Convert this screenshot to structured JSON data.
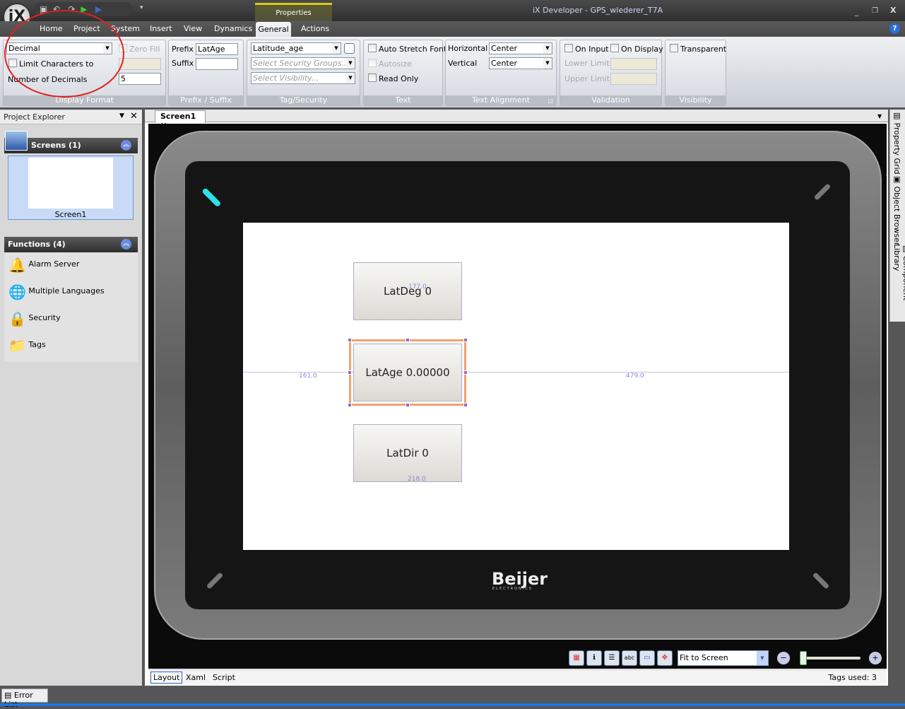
{
  "window": {
    "title": "iX Developer - GPS_wlederer_T7A",
    "logo": "iX",
    "context_tab": "Properties"
  },
  "menu_tabs": [
    "Home",
    "Project",
    "System",
    "Insert",
    "View",
    "Dynamics",
    "General",
    "Actions"
  ],
  "active_tab": "General",
  "ribbon": {
    "display_format": {
      "caption": "Display Format",
      "format_value": "Decimal",
      "zero_fill": "Zero Fill",
      "limit_chars": "Limit Characters to",
      "limit_value": "",
      "decimals_label": "Number of Decimals",
      "decimals_value": "5"
    },
    "prefix_suffix": {
      "caption": "Prefix / Suffix",
      "prefix_label": "Prefix",
      "prefix_value": "LatAge",
      "suffix_label": "Suffix",
      "suffix_value": ""
    },
    "tag_security": {
      "caption": "Tag/Security",
      "tag_value": "Latitude_age",
      "security_placeholder": "Select Security Groups...",
      "visibility_placeholder": "Select Visibility..."
    },
    "text": {
      "caption": "Text",
      "auto_stretch": "Auto Stretch Font",
      "autosize": "Autosize",
      "read_only": "Read Only"
    },
    "text_alignment": {
      "caption": "Text Alignment",
      "horizontal_label": "Horizontal",
      "horizontal_value": "Center",
      "vertical_label": "Vertical",
      "vertical_value": "Center"
    },
    "validation": {
      "caption": "Validation",
      "on_input": "On Input",
      "on_display": "On Display",
      "lower": "Lower Limit",
      "upper": "Upper Limit"
    },
    "visibility": {
      "caption": "Visibility",
      "transparent": "Transparent"
    }
  },
  "project_explorer": {
    "title": "Project Explorer",
    "screens_header": "Screens (1)",
    "screen_name": "Screen1",
    "functions_header": "Functions (4)",
    "functions": [
      {
        "label": "Alarm Server",
        "icon": "bell-icon"
      },
      {
        "label": "Multiple Languages",
        "icon": "globe-icon"
      },
      {
        "label": "Security",
        "icon": "lock-icon"
      },
      {
        "label": "Tags",
        "icon": "folder-icon"
      }
    ]
  },
  "editor": {
    "tab": "Screen1",
    "brand": "Beijer",
    "brand_sub": "ELECTRONICS",
    "objects": [
      {
        "label": "LatDeg 0"
      },
      {
        "label": "LatAge 0.00000",
        "selected": true
      },
      {
        "label": "LatDir 0"
      }
    ],
    "guides": {
      "left": "161.0",
      "right": "479.0",
      "top": "177.0",
      "bottom": "218.0"
    },
    "zoom_value": "Fit to Screen",
    "bottom_tabs": [
      "Layout",
      "Xaml",
      "Script"
    ],
    "active_bottom_tab": "Layout",
    "tags_used": "Tags used: 3"
  },
  "right_tabs": [
    "Property Grid",
    "Object Browser",
    "Component Library"
  ],
  "error_list": "Error List",
  "colors": {
    "selection": "#f0a070",
    "accent_cyan": "#2de0e8",
    "annotation_red": "#e02020"
  }
}
